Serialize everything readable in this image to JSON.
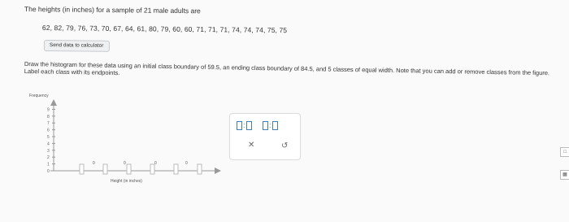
{
  "question": {
    "prompt": "The heights (in inches) for a sample of 21 male adults are",
    "data_values": "62, 82, 79, 76, 73, 70, 67, 64, 61, 80, 79, 60, 60, 71, 71, 71, 74, 74, 74, 75, 75",
    "send_button": "Send data to calculator",
    "instructions": "Draw the histogram for these data using an initial class boundary of 59.5, an ending class boundary of 84.5, and 5 classes of equal width. Note that you can add or remove classes from the figure. Label each class with its endpoints."
  },
  "chart": {
    "ylabel": "Frequency",
    "xlabel": "Height (in inches)",
    "yticks": [
      "0",
      "1",
      "2",
      "3",
      "4",
      "5",
      "6",
      "7",
      "8",
      "9"
    ],
    "bar_labels": [
      "0",
      "0",
      "0",
      "0"
    ]
  },
  "tools": {
    "clear_icon": "✕",
    "undo_icon": "↺"
  },
  "side": {
    "btn1": "□",
    "btn2": "▦"
  }
}
